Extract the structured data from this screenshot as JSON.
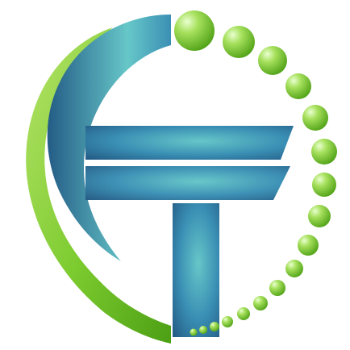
{
  "logo": {
    "brand_mark": "CT monogram",
    "colors": {
      "green_light": "#b6e36a",
      "green_mid": "#7ccb2f",
      "green_dark": "#4c9f14",
      "blue_light": "#66c7c8",
      "blue_mid": "#3a8fb4",
      "blue_dark": "#245c86",
      "background": "#ffffff"
    },
    "dots_count": 17
  }
}
